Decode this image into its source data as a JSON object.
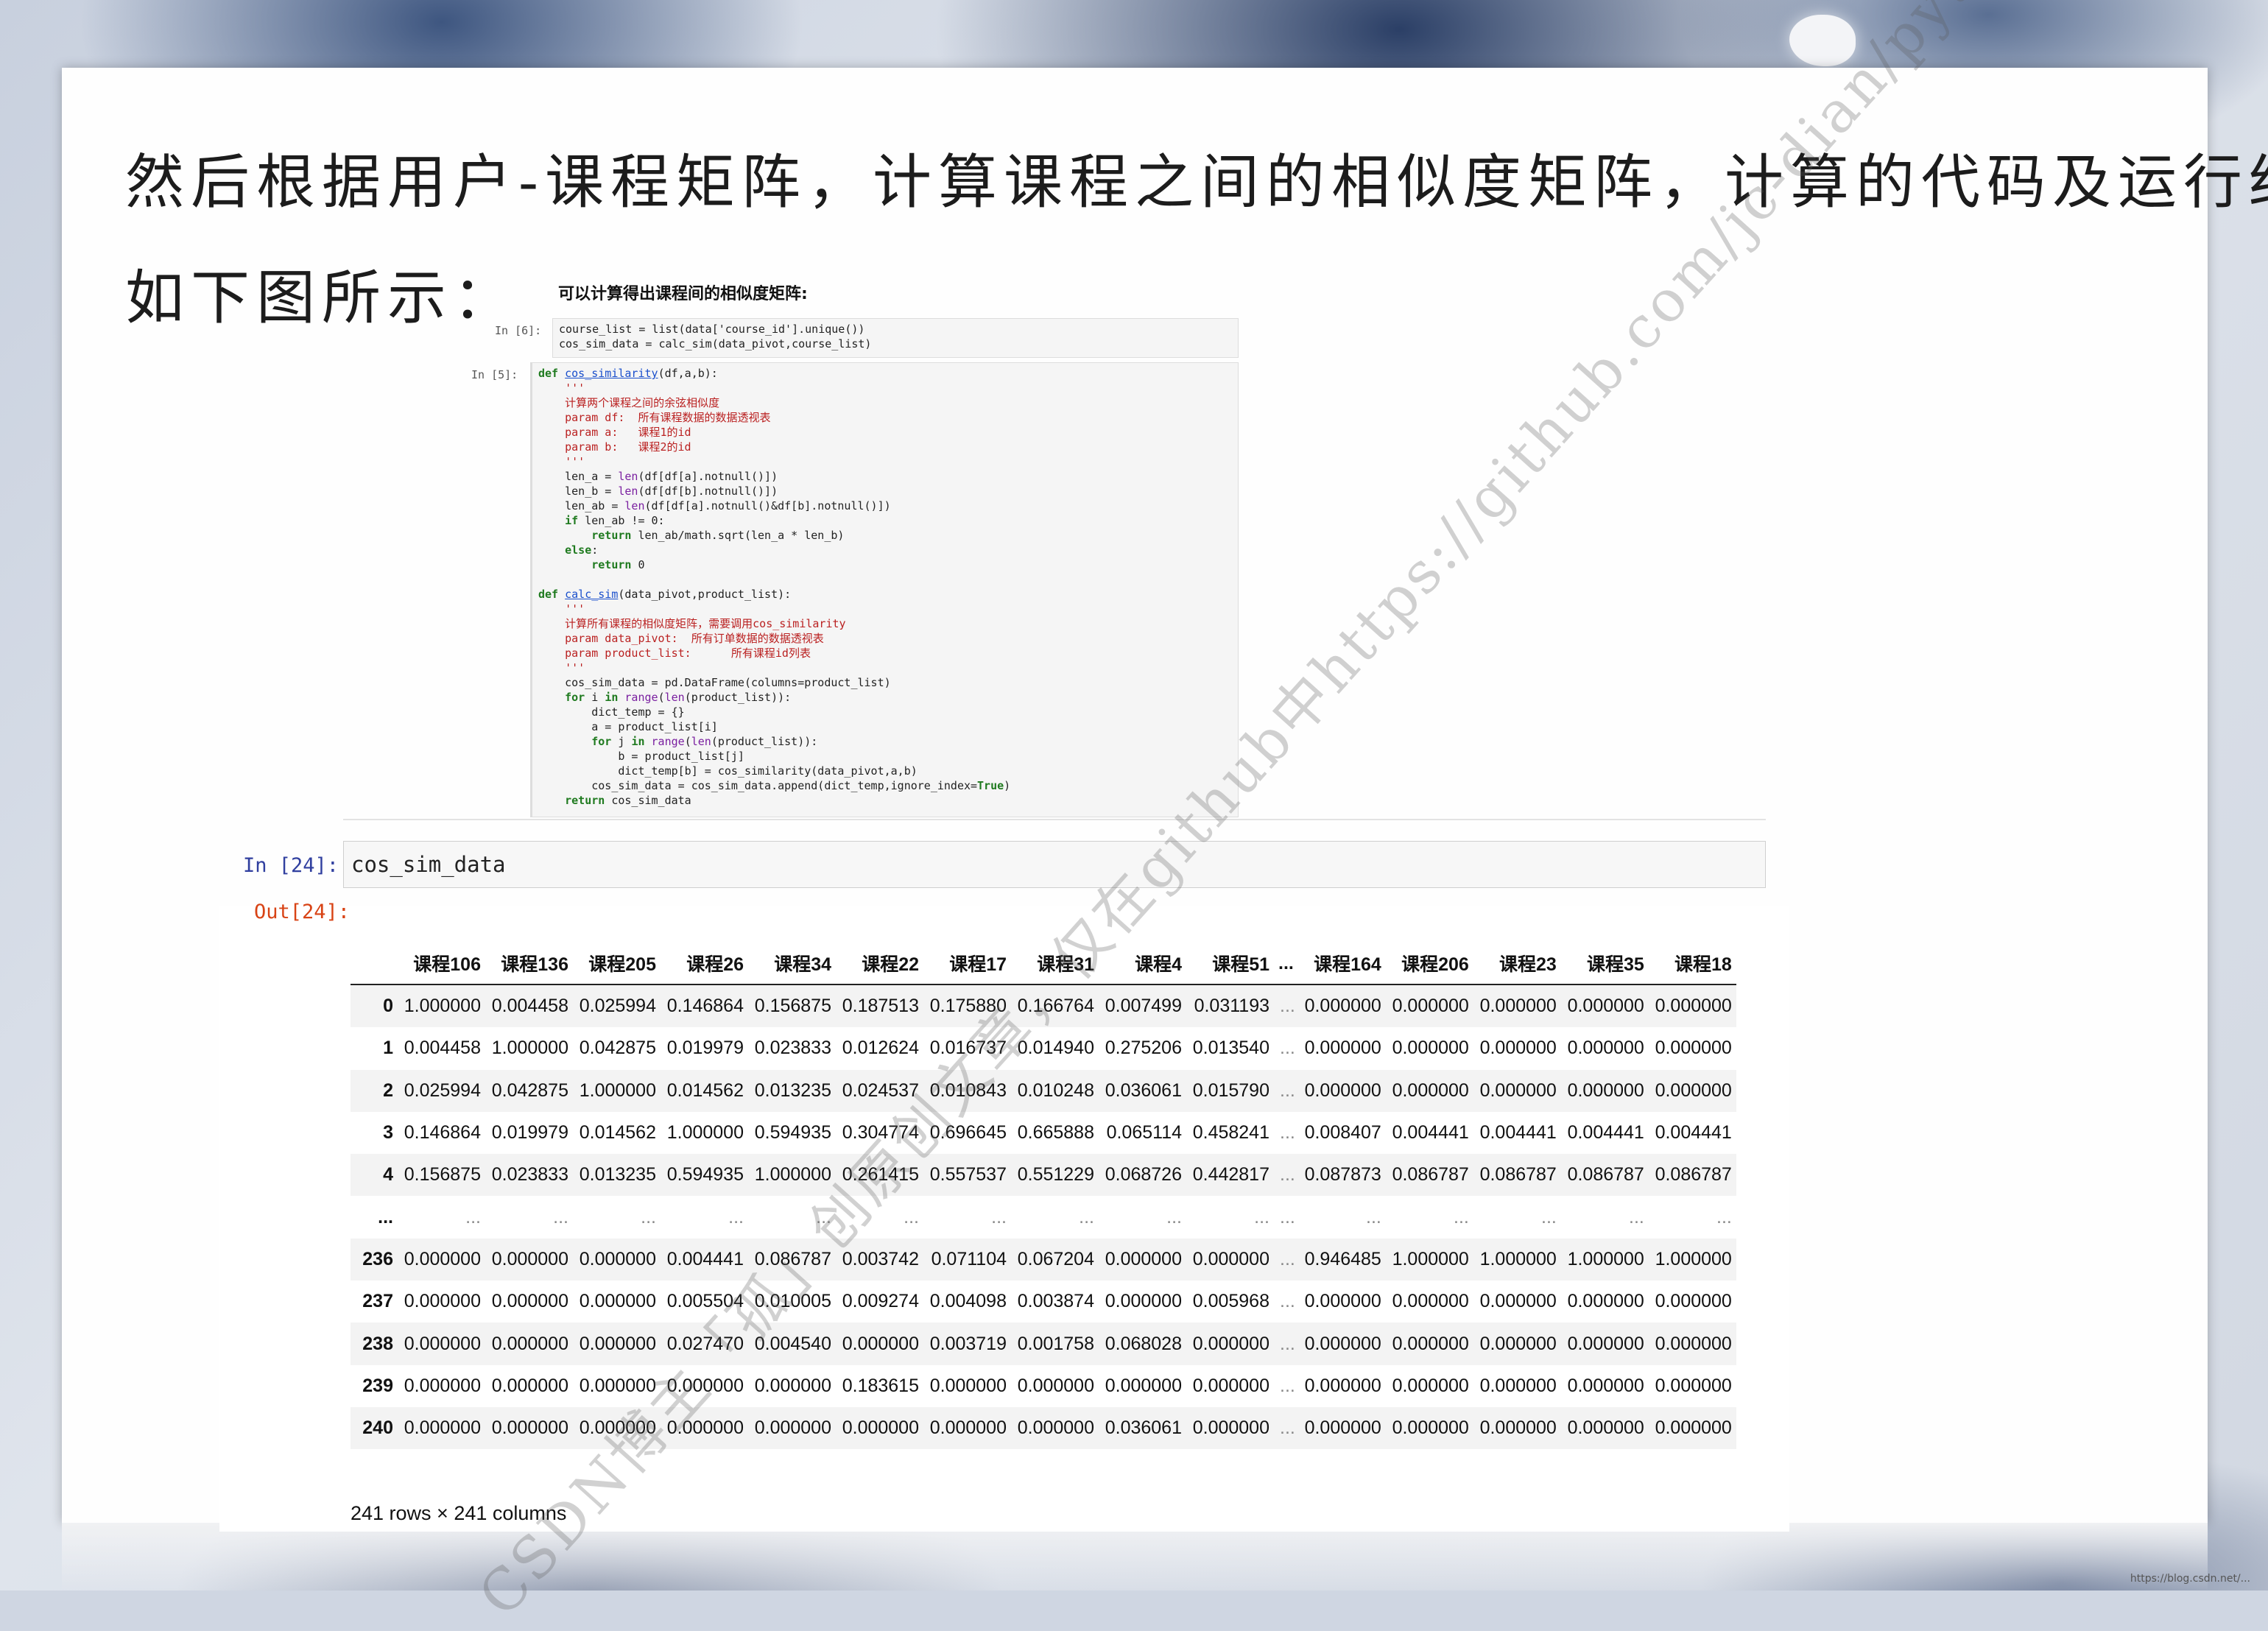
{
  "heading": {
    "line1": "然后根据用户-课程矩阵，计算课程之间的相似度矩阵，计算的代码及运行结果",
    "line2": "如下图所示："
  },
  "code_screenshot": {
    "caption": "可以计算得出课程间的相似度矩阵:",
    "prompt_6": "In [6]:",
    "prompt_5": "In [5]:",
    "cell6_line1": "course_list = list(data['course_id'].unique())",
    "cell6_line2": "cos_sim_data = calc_sim(data_pivot,course_list)"
  },
  "notebook": {
    "in_prompt": "In [24]:",
    "out_prompt": "Out[24]:",
    "input_code": "cos_sim_data",
    "columns": [
      "课程106",
      "课程136",
      "课程205",
      "课程26",
      "课程34",
      "课程22",
      "课程17",
      "课程31",
      "课程4",
      "课程51",
      "...",
      "课程164",
      "课程206",
      "课程23",
      "课程35",
      "课程18"
    ],
    "rows": [
      {
        "index": "0",
        "values": [
          "1.000000",
          "0.004458",
          "0.025994",
          "0.146864",
          "0.156875",
          "0.187513",
          "0.175880",
          "0.166764",
          "0.007499",
          "0.031193",
          "...",
          "0.000000",
          "0.000000",
          "0.000000",
          "0.000000",
          "0.000000"
        ]
      },
      {
        "index": "1",
        "values": [
          "0.004458",
          "1.000000",
          "0.042875",
          "0.019979",
          "0.023833",
          "0.012624",
          "0.016737",
          "0.014940",
          "0.275206",
          "0.013540",
          "...",
          "0.000000",
          "0.000000",
          "0.000000",
          "0.000000",
          "0.000000"
        ]
      },
      {
        "index": "2",
        "values": [
          "0.025994",
          "0.042875",
          "1.000000",
          "0.014562",
          "0.013235",
          "0.024537",
          "0.010843",
          "0.010248",
          "0.036061",
          "0.015790",
          "...",
          "0.000000",
          "0.000000",
          "0.000000",
          "0.000000",
          "0.000000"
        ]
      },
      {
        "index": "3",
        "values": [
          "0.146864",
          "0.019979",
          "0.014562",
          "1.000000",
          "0.594935",
          "0.304774",
          "0.696645",
          "0.665888",
          "0.065114",
          "0.458241",
          "...",
          "0.008407",
          "0.004441",
          "0.004441",
          "0.004441",
          "0.004441"
        ]
      },
      {
        "index": "4",
        "values": [
          "0.156875",
          "0.023833",
          "0.013235",
          "0.594935",
          "1.000000",
          "0.261415",
          "0.557537",
          "0.551229",
          "0.068726",
          "0.442817",
          "...",
          "0.087873",
          "0.086787",
          "0.086787",
          "0.086787",
          "0.086787"
        ]
      },
      {
        "index": "...",
        "values": [
          "...",
          "...",
          "...",
          "...",
          "...",
          "...",
          "...",
          "...",
          "...",
          "...",
          "...",
          "...",
          "...",
          "...",
          "...",
          "..."
        ]
      },
      {
        "index": "236",
        "values": [
          "0.000000",
          "0.000000",
          "0.000000",
          "0.004441",
          "0.086787",
          "0.003742",
          "0.071104",
          "0.067204",
          "0.000000",
          "0.000000",
          "...",
          "0.946485",
          "1.000000",
          "1.000000",
          "1.000000",
          "1.000000"
        ]
      },
      {
        "index": "237",
        "values": [
          "0.000000",
          "0.000000",
          "0.000000",
          "0.005504",
          "0.010005",
          "0.009274",
          "0.004098",
          "0.003874",
          "0.000000",
          "0.005968",
          "...",
          "0.000000",
          "0.000000",
          "0.000000",
          "0.000000",
          "0.000000"
        ]
      },
      {
        "index": "238",
        "values": [
          "0.000000",
          "0.000000",
          "0.000000",
          "0.027470",
          "0.004540",
          "0.000000",
          "0.003719",
          "0.001758",
          "0.068028",
          "0.000000",
          "...",
          "0.000000",
          "0.000000",
          "0.000000",
          "0.000000",
          "0.000000"
        ]
      },
      {
        "index": "239",
        "values": [
          "0.000000",
          "0.000000",
          "0.000000",
          "0.000000",
          "0.000000",
          "0.183615",
          "0.000000",
          "0.000000",
          "0.000000",
          "0.000000",
          "...",
          "0.000000",
          "0.000000",
          "0.000000",
          "0.000000",
          "0.000000"
        ]
      },
      {
        "index": "240",
        "values": [
          "0.000000",
          "0.000000",
          "0.000000",
          "0.000000",
          "0.000000",
          "0.000000",
          "0.000000",
          "0.000000",
          "0.036061",
          "0.000000",
          "...",
          "0.000000",
          "0.000000",
          "0.000000",
          "0.000000",
          "0.000000"
        ]
      }
    ],
    "shape": "241 rows × 241 columns"
  },
  "watermark": "CSDN博主「孤」创原创文章，仅在github中https://github.com/jc-dian/python_data",
  "credit": "https://blog.csdn.net/..."
}
